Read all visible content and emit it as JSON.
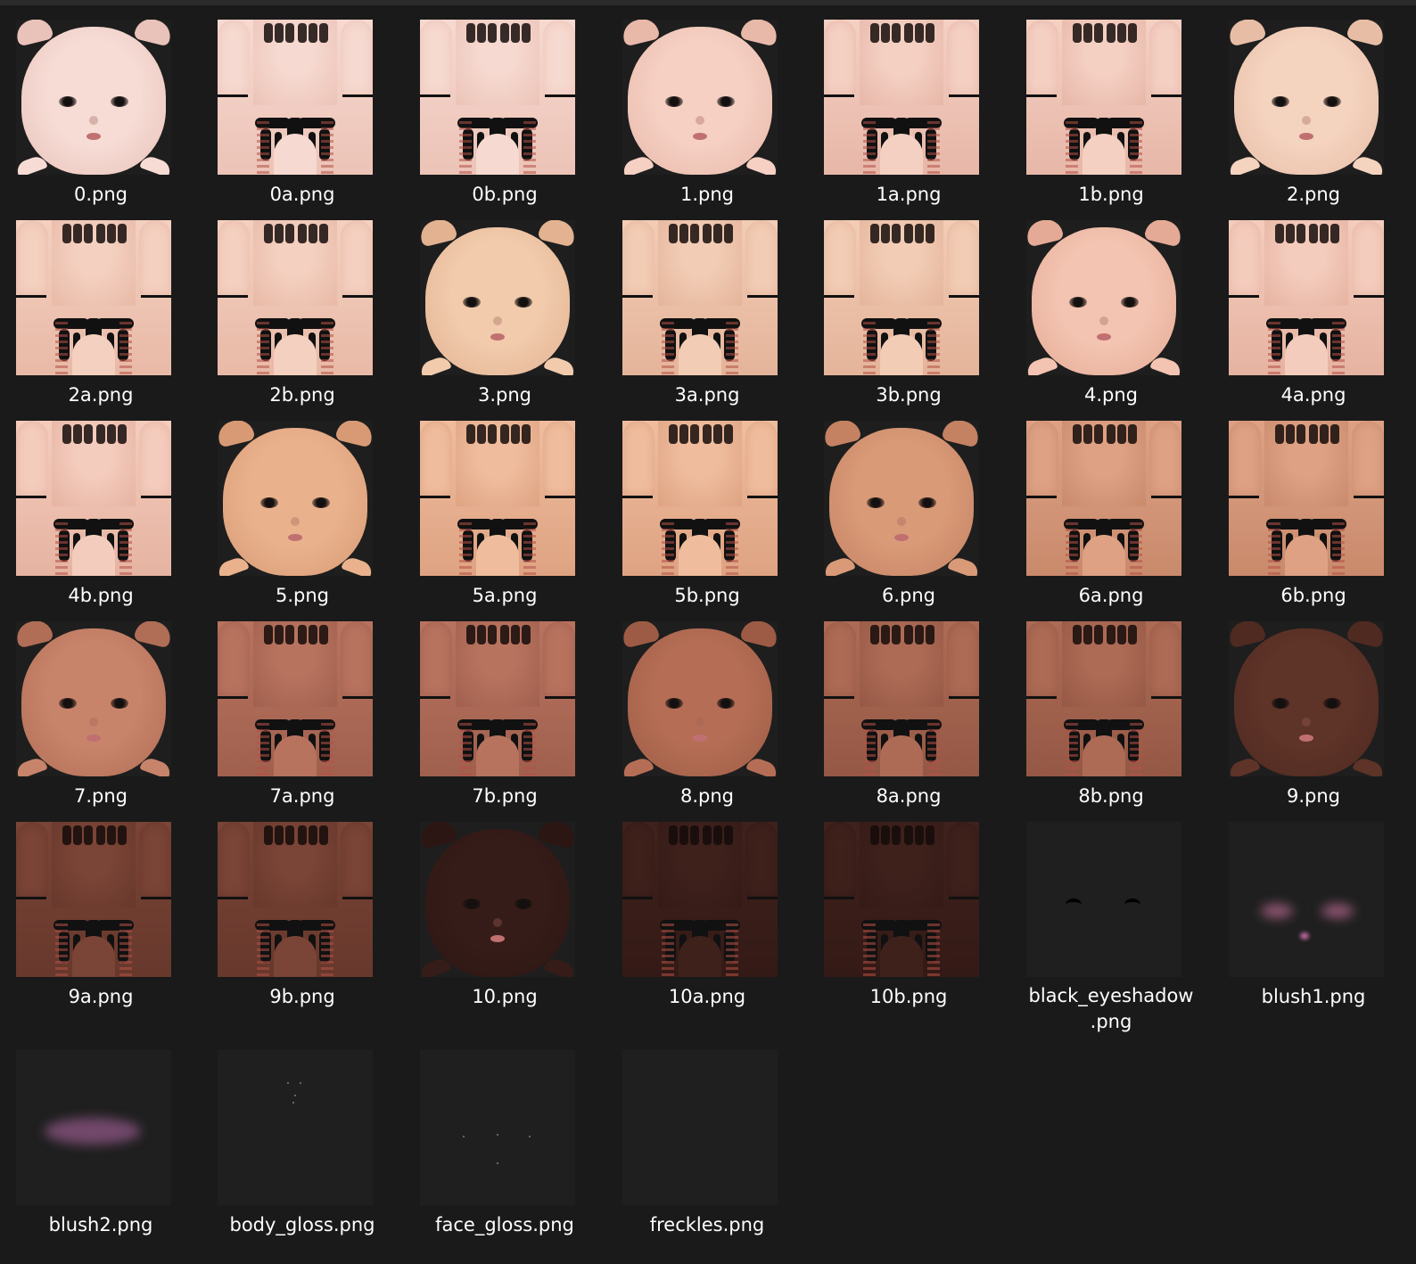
{
  "files": [
    {
      "name": "0.png",
      "kind": "head",
      "skin": "#f6dcd5",
      "shade": "#e9c2b9"
    },
    {
      "name": "0a.png",
      "kind": "body",
      "skin": "#f6d9d0",
      "shade": "#ecc3b7"
    },
    {
      "name": "0b.png",
      "kind": "body",
      "skin": "#f6d9d0",
      "shade": "#ecc3b7"
    },
    {
      "name": "1.png",
      "kind": "head",
      "skin": "#f5d0c3",
      "shade": "#e8b8a9"
    },
    {
      "name": "1a.png",
      "kind": "body",
      "skin": "#f4d0c3",
      "shade": "#e7b7a8"
    },
    {
      "name": "1b.png",
      "kind": "body",
      "skin": "#f4d0c3",
      "shade": "#e7b7a8"
    },
    {
      "name": "2.png",
      "kind": "head",
      "skin": "#f4d3bf",
      "shade": "#e8bda6"
    },
    {
      "name": "2a.png",
      "kind": "body",
      "skin": "#f4d0c0",
      "shade": "#e8b9a6"
    },
    {
      "name": "2b.png",
      "kind": "body",
      "skin": "#f4d0c0",
      "shade": "#e8b9a6"
    },
    {
      "name": "3.png",
      "kind": "head",
      "skin": "#f1cbac",
      "shade": "#e2b291"
    },
    {
      "name": "3a.png",
      "kind": "body",
      "skin": "#f2ccb5",
      "shade": "#e4b49a"
    },
    {
      "name": "3b.png",
      "kind": "body",
      "skin": "#f2ccb5",
      "shade": "#e4b49a"
    },
    {
      "name": "4.png",
      "kind": "head",
      "skin": "#f3c4b1",
      "shade": "#e4aa95"
    },
    {
      "name": "4a.png",
      "kind": "body",
      "skin": "#f4ccbd",
      "shade": "#e6b3a1"
    },
    {
      "name": "4b.png",
      "kind": "body",
      "skin": "#f4ccbd",
      "shade": "#e6b3a1"
    },
    {
      "name": "5.png",
      "kind": "head",
      "skin": "#e9b28d",
      "shade": "#d89a74"
    },
    {
      "name": "5a.png",
      "kind": "body",
      "skin": "#efbd9e",
      "shade": "#dea382"
    },
    {
      "name": "5b.png",
      "kind": "body",
      "skin": "#efbd9e",
      "shade": "#dea382"
    },
    {
      "name": "6.png",
      "kind": "head",
      "skin": "#d99a78",
      "shade": "#c48262"
    },
    {
      "name": "6a.png",
      "kind": "body",
      "skin": "#dea184",
      "shade": "#c98a6c"
    },
    {
      "name": "6b.png",
      "kind": "body",
      "skin": "#dea184",
      "shade": "#c98a6c"
    },
    {
      "name": "7.png",
      "kind": "head",
      "skin": "#c8846a",
      "shade": "#b06e56"
    },
    {
      "name": "7a.png",
      "kind": "body",
      "skin": "#b8735f",
      "shade": "#a0604e"
    },
    {
      "name": "7b.png",
      "kind": "body",
      "skin": "#b8735f",
      "shade": "#a0604e"
    },
    {
      "name": "8.png",
      "kind": "head",
      "skin": "#b56e55",
      "shade": "#9d5b45"
    },
    {
      "name": "8a.png",
      "kind": "body",
      "skin": "#ad6b55",
      "shade": "#955845"
    },
    {
      "name": "8b.png",
      "kind": "body",
      "skin": "#ad6b55",
      "shade": "#955845"
    },
    {
      "name": "9.png",
      "kind": "head",
      "skin": "#5e3328",
      "shade": "#4f2a20"
    },
    {
      "name": "9a.png",
      "kind": "body",
      "skin": "#7a4436",
      "shade": "#67382c"
    },
    {
      "name": "9b.png",
      "kind": "body",
      "skin": "#7a4436",
      "shade": "#67382c"
    },
    {
      "name": "10.png",
      "kind": "head",
      "skin": "#361c18",
      "shade": "#2c1613"
    },
    {
      "name": "10a.png",
      "kind": "body",
      "skin": "#3f211c",
      "shade": "#341a16"
    },
    {
      "name": "10b.png",
      "kind": "body",
      "skin": "#3f211c",
      "shade": "#341a16"
    },
    {
      "name": "black_eyeshadow .png",
      "kind": "eyeshadow"
    },
    {
      "name": "blush1.png",
      "kind": "blush1"
    },
    {
      "name": "blush2.png",
      "kind": "blush2"
    },
    {
      "name": "body_gloss.png",
      "kind": "bodygloss"
    },
    {
      "name": "face_gloss.png",
      "kind": "facegloss"
    },
    {
      "name": "freckles.png",
      "kind": "freckles"
    }
  ]
}
